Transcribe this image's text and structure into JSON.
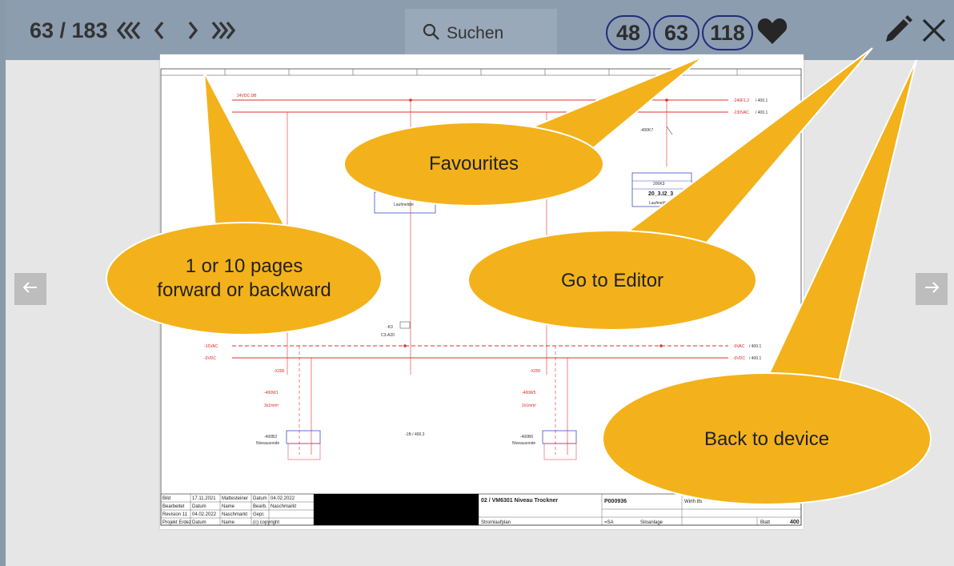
{
  "toolbar": {
    "page_indicator": "63 / 183",
    "nav": {
      "back10": "back-10-pages-icon",
      "back1": "back-1-page-icon",
      "fwd1": "forward-1-page-icon",
      "fwd10": "forward-10-pages-icon"
    },
    "search_placeholder": "Suchen",
    "favourites": [
      "48",
      "63",
      "118"
    ],
    "accent": "#232a7a"
  },
  "callouts": {
    "favourites": "Favourites",
    "pages_line1": "1 or 10 pages",
    "pages_line2": "forward or backward",
    "editor": "Go to Editor",
    "device": "Back to device",
    "bubble_color": "#f3b21b"
  },
  "document": {
    "rails": {
      "top1": "24VDC DB",
      "top1_right": "-240F1.2",
      "top1_ref": "/ 400.1",
      "top2_right": "-230VAC",
      "top2_ref": "/ 400.1",
      "bot1_left": "-16VAC",
      "bot1_right": "-0VAC",
      "bot1_ref": "/ 400.1",
      "bot2_left": "-0VDC",
      "bot2_right": "-0VDC",
      "bot2_ref": "/ 400.1"
    },
    "labels": {
      "relay": "-400K7",
      "module_a": "200K3",
      "module_b": "20_3.I2_3",
      "contact": "-K3",
      "contact_sub": "C3-A20",
      "term1": "-X200",
      "term2": "-X200",
      "cable1": "-400W1",
      "cable1_sub": "3x1mm²",
      "cable2": "-400W5",
      "cable2_sub": "2x1mm²",
      "sensor1": "-400B2",
      "sensor1_sub": "Niveausonde",
      "sensor2": "-400B6",
      "sensor2_sub": "Niveausonde",
      "lvl_note": "-1B / 400.3",
      "box_left": "Laufmelder",
      "box_right": "Laufmelder"
    },
    "title_block": {
      "project_title": "02 / VM6301 Niveau Trockner",
      "project_no": "P000936",
      "customer": "Wirth 85",
      "type": "Stromlaufplan",
      "plant": "=SA",
      "plant_name": "Siloanlage",
      "sheet_label": "Blatt",
      "sheet": "400",
      "rows": [
        [
          "Bild",
          "17.11.2021",
          "Mattesteiner",
          "Datum",
          "04.02.2022"
        ],
        [
          "Bearbeitet",
          "Datum",
          "Name",
          "Bearb.",
          "Naschmarkt"
        ],
        [
          "Revision 11",
          "04.02.2022",
          "Naschmarkt",
          "Gepr.",
          ""
        ],
        [
          "Projekt Erdez",
          "Datum",
          "Name",
          "(c) copyright",
          ""
        ]
      ]
    }
  }
}
